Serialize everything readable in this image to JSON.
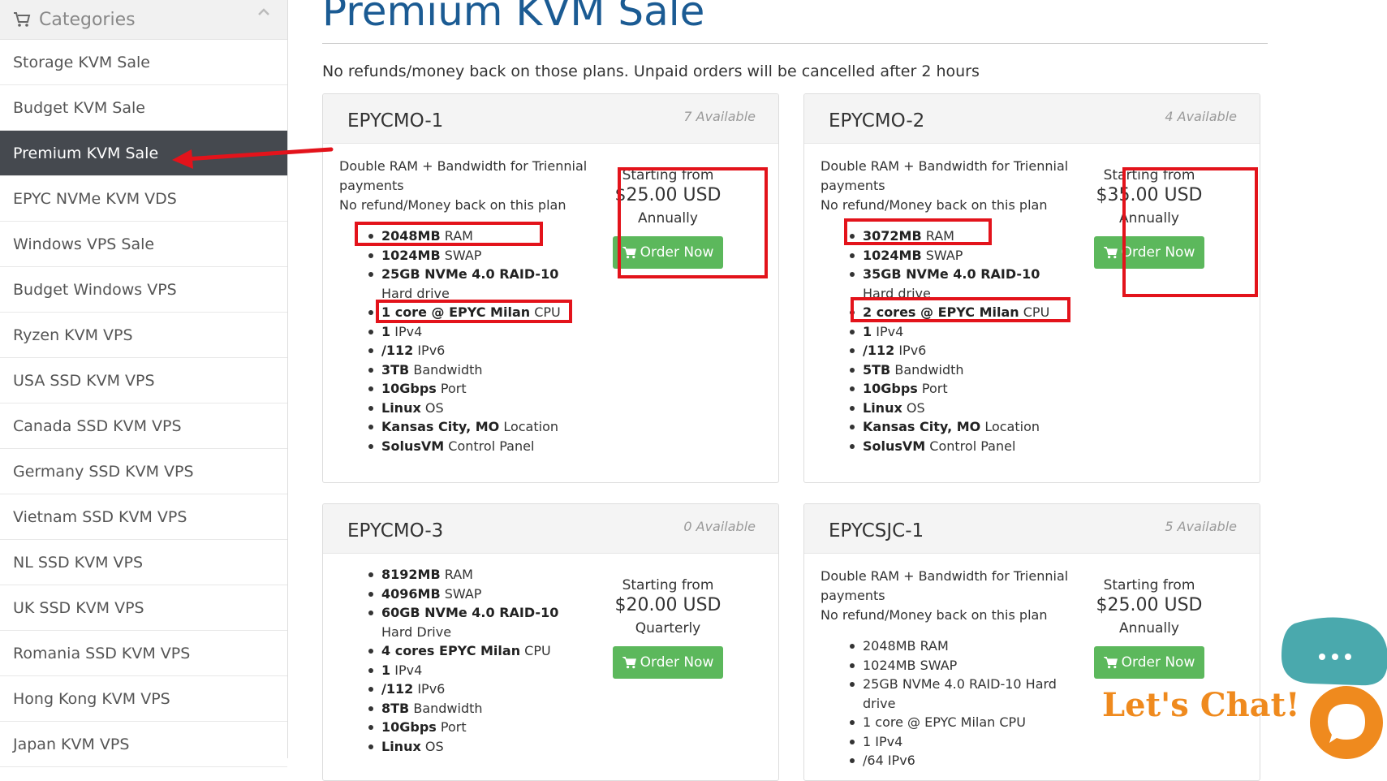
{
  "sidebar": {
    "header": "Categories",
    "items": [
      {
        "label": "Storage KVM Sale",
        "active": false
      },
      {
        "label": "Budget KVM Sale",
        "active": false
      },
      {
        "label": "Premium KVM Sale",
        "active": true
      },
      {
        "label": "EPYC NVMe KVM VDS",
        "active": false
      },
      {
        "label": "Windows VPS Sale",
        "active": false
      },
      {
        "label": "Budget Windows VPS",
        "active": false
      },
      {
        "label": "Ryzen KVM VPS",
        "active": false
      },
      {
        "label": "USA SSD KVM VPS",
        "active": false
      },
      {
        "label": "Canada SSD KVM VPS",
        "active": false
      },
      {
        "label": "Germany SSD KVM VPS",
        "active": false
      },
      {
        "label": "Vietnam SSD KVM VPS",
        "active": false
      },
      {
        "label": "NL SSD KVM VPS",
        "active": false
      },
      {
        "label": "UK SSD KVM VPS",
        "active": false
      },
      {
        "label": "Romania SSD KVM VPS",
        "active": false
      },
      {
        "label": "Hong Kong KVM VPS",
        "active": false
      },
      {
        "label": "Japan KVM VPS",
        "active": false
      }
    ]
  },
  "main": {
    "title": "Premium KVM Sale",
    "notice": "No refunds/money back on those plans. Unpaid orders will be cancelled after 2 hours"
  },
  "products": [
    {
      "name": "EPYCMO-1",
      "available": "7 Available",
      "desc": [
        "Double RAM + Bandwidth for Triennial payments",
        "No refund/Money back on this plan"
      ],
      "features": [
        {
          "b": "2048MB",
          "t": " RAM"
        },
        {
          "b": "1024MB",
          "t": " SWAP"
        },
        {
          "b": "25GB NVMe 4.0 RAID-10",
          "t": " Hard drive"
        },
        {
          "b": "1 core @ EPYC Milan",
          "t": " CPU"
        },
        {
          "b": "1",
          "t": " IPv4"
        },
        {
          "b": "/112",
          "t": " IPv6"
        },
        {
          "b": "3TB",
          "t": " Bandwidth"
        },
        {
          "b": "10Gbps",
          "t": " Port"
        },
        {
          "b": "Linux",
          "t": " OS"
        },
        {
          "b": "Kansas City, MO",
          "t": " Location"
        },
        {
          "b": "SolusVM",
          "t": " Control Panel"
        }
      ],
      "starting": "Starting from",
      "price": "$25.00 USD",
      "cycle": "Annually",
      "order": "Order Now"
    },
    {
      "name": "EPYCMO-2",
      "available": "4 Available",
      "desc": [
        "Double RAM + Bandwidth for Triennial payments",
        "No refund/Money back on this plan"
      ],
      "features": [
        {
          "b": "3072MB",
          "t": " RAM"
        },
        {
          "b": "1024MB",
          "t": " SWAP"
        },
        {
          "b": "35GB NVMe 4.0 RAID-10",
          "t": " Hard drive"
        },
        {
          "b": "2 cores @ EPYC Milan",
          "t": " CPU"
        },
        {
          "b": "1",
          "t": " IPv4"
        },
        {
          "b": "/112",
          "t": " IPv6"
        },
        {
          "b": "5TB",
          "t": " Bandwidth"
        },
        {
          "b": "10Gbps",
          "t": " Port"
        },
        {
          "b": "Linux",
          "t": " OS"
        },
        {
          "b": "Kansas City, MO",
          "t": " Location"
        },
        {
          "b": "SolusVM",
          "t": " Control Panel"
        }
      ],
      "starting": "Starting from",
      "price": "$35.00 USD",
      "cycle": "Annually",
      "order": "Order Now"
    },
    {
      "name": "EPYCMO-3",
      "available": "0 Available",
      "desc": [],
      "features": [
        {
          "b": "8192MB",
          "t": " RAM"
        },
        {
          "b": "4096MB",
          "t": " SWAP"
        },
        {
          "b": "60GB NVMe 4.0 RAID-10",
          "t": " Hard Drive"
        },
        {
          "b": "4 cores EPYC Milan",
          "t": " CPU"
        },
        {
          "b": "1",
          "t": " IPv4"
        },
        {
          "b": "/112",
          "t": " IPv6"
        },
        {
          "b": "8TB",
          "t": " Bandwidth"
        },
        {
          "b": "10Gbps",
          "t": " Port"
        },
        {
          "b": "Linux",
          "t": " OS"
        }
      ],
      "starting": "Starting from",
      "price": "$20.00 USD",
      "cycle": "Quarterly",
      "order": "Order Now"
    },
    {
      "name": "EPYCSJC-1",
      "available": "5 Available",
      "desc": [
        "Double RAM + Bandwidth for Triennial payments",
        "No refund/Money back on this plan"
      ],
      "features": [
        {
          "b": "",
          "t": "2048MB RAM"
        },
        {
          "b": "",
          "t": "1024MB SWAP"
        },
        {
          "b": "",
          "t": "25GB NVMe 4.0 RAID-10 Hard drive"
        },
        {
          "b": "",
          "t": "1 core @ EPYC Milan CPU"
        },
        {
          "b": "",
          "t": "1 IPv4"
        },
        {
          "b": "",
          "t": "/64 IPv6"
        }
      ],
      "starting": "Starting from",
      "price": "$25.00 USD",
      "cycle": "Annually",
      "order": "Order Now"
    }
  ],
  "chat": {
    "label": "Let's Chat!",
    "bubble_color": "#4aa9ad",
    "accent_color": "#ef8a1e"
  },
  "colors": {
    "title_blue": "#1b5b93",
    "button_green": "#5cb85c",
    "active_sidebar": "#45494f",
    "highlight_red": "#e3131b"
  }
}
